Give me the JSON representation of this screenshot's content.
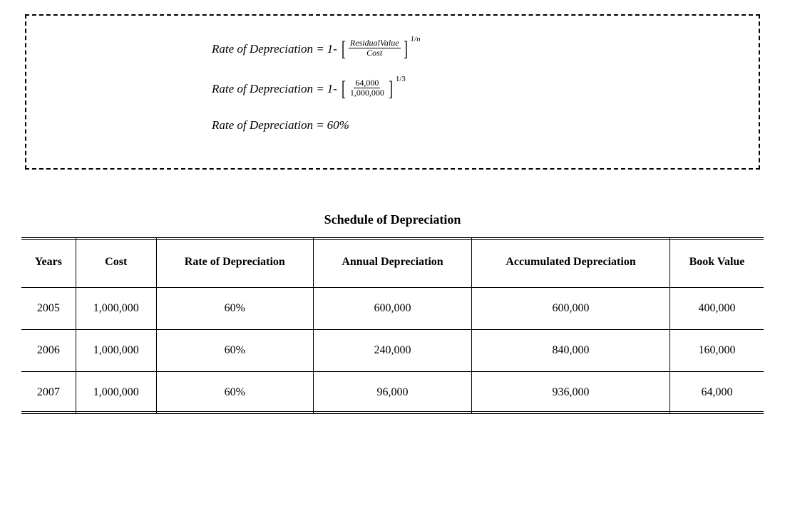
{
  "formula": {
    "label": "Rate of Depreciation =",
    "one_minus": "1-",
    "generic": {
      "numerator_prefix": "R",
      "numerator_mid": "esidual",
      "numerator_suffix_italic_v": "V",
      "numerator_suffix": "alue",
      "denominator": "Cost",
      "exponent": "1/n"
    },
    "numeric": {
      "numerator": "64,000",
      "denominator": "1,000,000",
      "exponent": "1/3"
    },
    "result_label": "Rate of Depreciation =",
    "result_value": "60%"
  },
  "table": {
    "title": "Schedule of Depreciation",
    "headers": [
      "Years",
      "Cost",
      "Rate of Depreciation",
      "Annual Depreciation",
      "Accumulated Depreciation",
      "Book Value"
    ],
    "rows": [
      {
        "year": "2005",
        "cost": "1,000,000",
        "rate": "60%",
        "annual": "600,000",
        "accum": "600,000",
        "book": "400,000"
      },
      {
        "year": "2006",
        "cost": "1,000,000",
        "rate": "60%",
        "annual": "240,000",
        "accum": "840,000",
        "book": "160,000"
      },
      {
        "year": "2007",
        "cost": "1,000,000",
        "rate": "60%",
        "annual": "96,000",
        "accum": "936,000",
        "book": "64,000"
      }
    ]
  }
}
